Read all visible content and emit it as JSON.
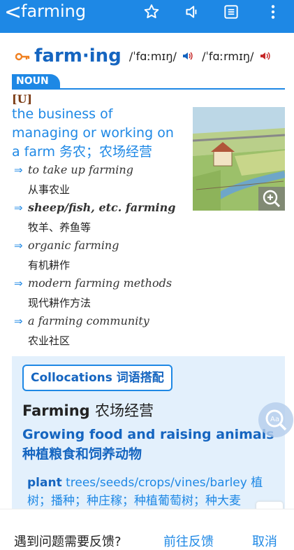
{
  "appbar": {
    "back_glyph": "<",
    "title": "farming",
    "icons": [
      "star-icon",
      "speaker-icon",
      "document-icon",
      "more-vertical-icon"
    ]
  },
  "entry": {
    "headword": "farm·ing",
    "ipa_uk": "/ˈfɑːmɪŋ/",
    "ipa_us": "/ˈfɑːrmɪŋ/",
    "pos": "NOUN",
    "grammar": "[U]",
    "definition": "the business of managing or working on a farm 务农；农场经营",
    "examples": [
      {
        "en": "to take up farming",
        "cn": "从事农业",
        "bold": false
      },
      {
        "en": "sheep/fish, etc. farming",
        "cn": "牧羊、养鱼等",
        "bold": true
      },
      {
        "en": "organic farming",
        "cn": "有机耕作",
        "bold": false
      },
      {
        "en": "modern farming methods",
        "cn": "现代耕作方法",
        "bold": false
      },
      {
        "en": "a farming community",
        "cn": "农业社区",
        "bold": false
      }
    ]
  },
  "collocations": {
    "button": "Collocations 词语搭配",
    "heading_en": "Farming",
    "heading_cn": "农场经营",
    "sense": "Growing food and raising animals 种植粮食和饲养动物",
    "line_key": "plant",
    "line_rest": "trees/seeds/crops/vines/barley 植树；播种；种庄稼；种植葡萄树；种大麦"
  },
  "feedback": {
    "question": "遇到问题需要反馈?",
    "go": "前往反馈",
    "cancel": "取消"
  },
  "colors": {
    "accent": "#1e88e5",
    "headword": "#1565c0",
    "collocation_bg": "#e3f0fc"
  }
}
